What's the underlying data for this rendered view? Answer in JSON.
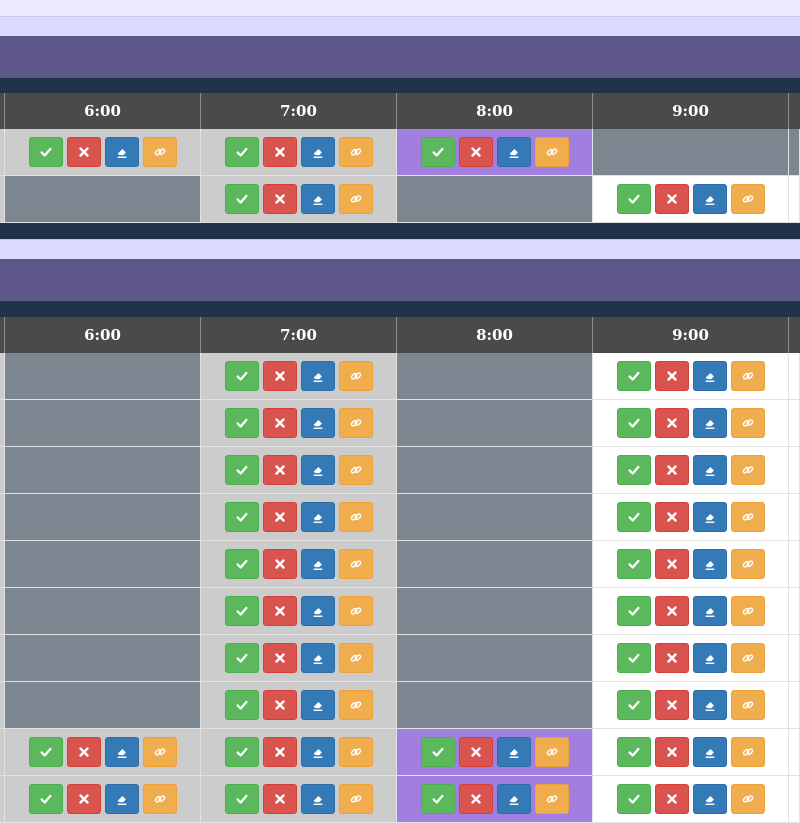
{
  "columns": [
    "6:00",
    "7:00",
    "8:00",
    "9:00"
  ],
  "colors": {
    "available": "#ffffff",
    "partial": "#cccccc",
    "unavailable": "#7b8690",
    "selected": "#a07fde",
    "ok_button": "#5cb85c",
    "delete_button": "#d9534f",
    "clear_button": "#337ab7",
    "link_button": "#f0ad4e"
  },
  "icons": {
    "ok": "check-icon",
    "delete": "times-icon",
    "clear": "eraser-icon",
    "link": "link-icon"
  },
  "tables": [
    {
      "rows": [
        [
          "gray-btn",
          "gray-btn",
          "purple-btn",
          "dark"
        ],
        [
          "dark",
          "gray-btn",
          "dark",
          "white-btn"
        ]
      ]
    },
    {
      "rows": [
        [
          "dark",
          "gray-btn",
          "dark",
          "white-btn"
        ],
        [
          "dark",
          "gray-btn",
          "dark",
          "white-btn"
        ],
        [
          "dark",
          "gray-btn",
          "dark",
          "white-btn"
        ],
        [
          "dark",
          "gray-btn",
          "dark",
          "white-btn"
        ],
        [
          "dark",
          "gray-btn",
          "dark",
          "white-btn"
        ],
        [
          "dark",
          "gray-btn",
          "dark",
          "white-btn"
        ],
        [
          "dark",
          "gray-btn",
          "dark",
          "white-btn"
        ],
        [
          "dark",
          "gray-btn",
          "dark",
          "white-btn"
        ],
        [
          "gray-btn",
          "gray-btn",
          "purple-btn",
          "white-btn"
        ],
        [
          "gray-btn",
          "gray-btn",
          "purple-btn",
          "white-btn"
        ]
      ]
    }
  ]
}
